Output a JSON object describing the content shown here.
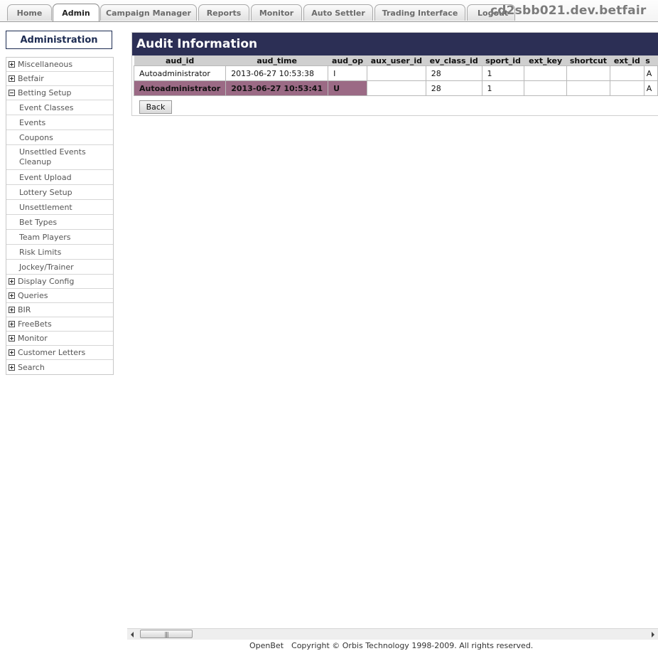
{
  "tabs": [
    "Home",
    "Admin",
    "Campaign Manager",
    "Reports",
    "Monitor",
    "Auto Settler",
    "Trading Interface",
    "Logout"
  ],
  "active_tab": "Admin",
  "hostname": "cd2sbb021.dev.betfair",
  "sidebar": {
    "title": "Administration",
    "items": [
      {
        "label": "Miscellaneous",
        "icon": "plus-icon"
      },
      {
        "label": "Betfair",
        "icon": "plus-icon"
      },
      {
        "label": "Betting Setup",
        "icon": "minus-icon"
      },
      {
        "label": "Event Classes"
      },
      {
        "label": "Events"
      },
      {
        "label": "Coupons"
      },
      {
        "label": "Unsettled Events Cleanup"
      },
      {
        "label": "Event Upload"
      },
      {
        "label": "Lottery Setup"
      },
      {
        "label": "Unsettlement"
      },
      {
        "label": "Bet Types"
      },
      {
        "label": "Team Players"
      },
      {
        "label": "Risk Limits"
      },
      {
        "label": "Jockey/Trainer"
      },
      {
        "label": "Display Config",
        "icon": "plus-icon"
      },
      {
        "label": "Queries",
        "icon": "plus-icon"
      },
      {
        "label": "BIR",
        "icon": "plus-icon"
      },
      {
        "label": "FreeBets",
        "icon": "plus-icon"
      },
      {
        "label": "Monitor",
        "icon": "plus-icon"
      },
      {
        "label": "Customer Letters",
        "icon": "plus-icon"
      },
      {
        "label": "Search",
        "icon": "plus-icon"
      }
    ]
  },
  "main": {
    "title": "Audit Information",
    "columns": [
      "aud_id",
      "aud_time",
      "aud_op",
      "aux_user_id",
      "ev_class_id",
      "sport_id",
      "ext_key",
      "shortcut",
      "ext_id",
      "s"
    ],
    "rows": [
      [
        "Autoadministrator",
        "2013-06-27 10:53:38",
        "I",
        "",
        "28",
        "1",
        "",
        "",
        "",
        "A"
      ],
      [
        "Autoadministrator",
        "2013-06-27 10:53:41",
        "U",
        "",
        "28",
        "1",
        "",
        "",
        "",
        "A"
      ]
    ],
    "highlight_color": "#9b6a85",
    "back_label": "Back"
  },
  "footer": {
    "product": "OpenBet",
    "copyright": "Copyright © Orbis Technology 1998-2009. All rights reserved."
  }
}
